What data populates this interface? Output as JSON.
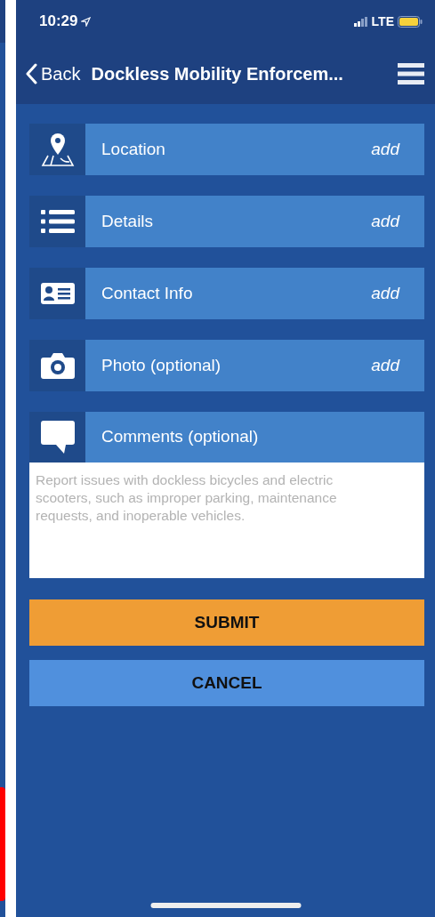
{
  "status_bar": {
    "time": "10:29",
    "network": "LTE"
  },
  "nav": {
    "back": "Back",
    "title": "Dockless Mobility Enforcem..."
  },
  "rows": [
    {
      "kind": "location",
      "label": "Location",
      "action": "add"
    },
    {
      "kind": "details",
      "label": "Details",
      "action": "add"
    },
    {
      "kind": "contact",
      "label": "Contact Info",
      "action": "add"
    },
    {
      "kind": "photo",
      "label": "Photo (optional)",
      "action": "add"
    }
  ],
  "comments": {
    "label": "Comments (optional)",
    "placeholder": "Report issues with dockless bicycles and electric scooters, such as improper parking, maintenance requests, and inoperable vehicles."
  },
  "buttons": [
    {
      "kind": "primary",
      "label": "SUBMIT"
    },
    {
      "kind": "secondary",
      "label": "CANCEL"
    }
  ]
}
